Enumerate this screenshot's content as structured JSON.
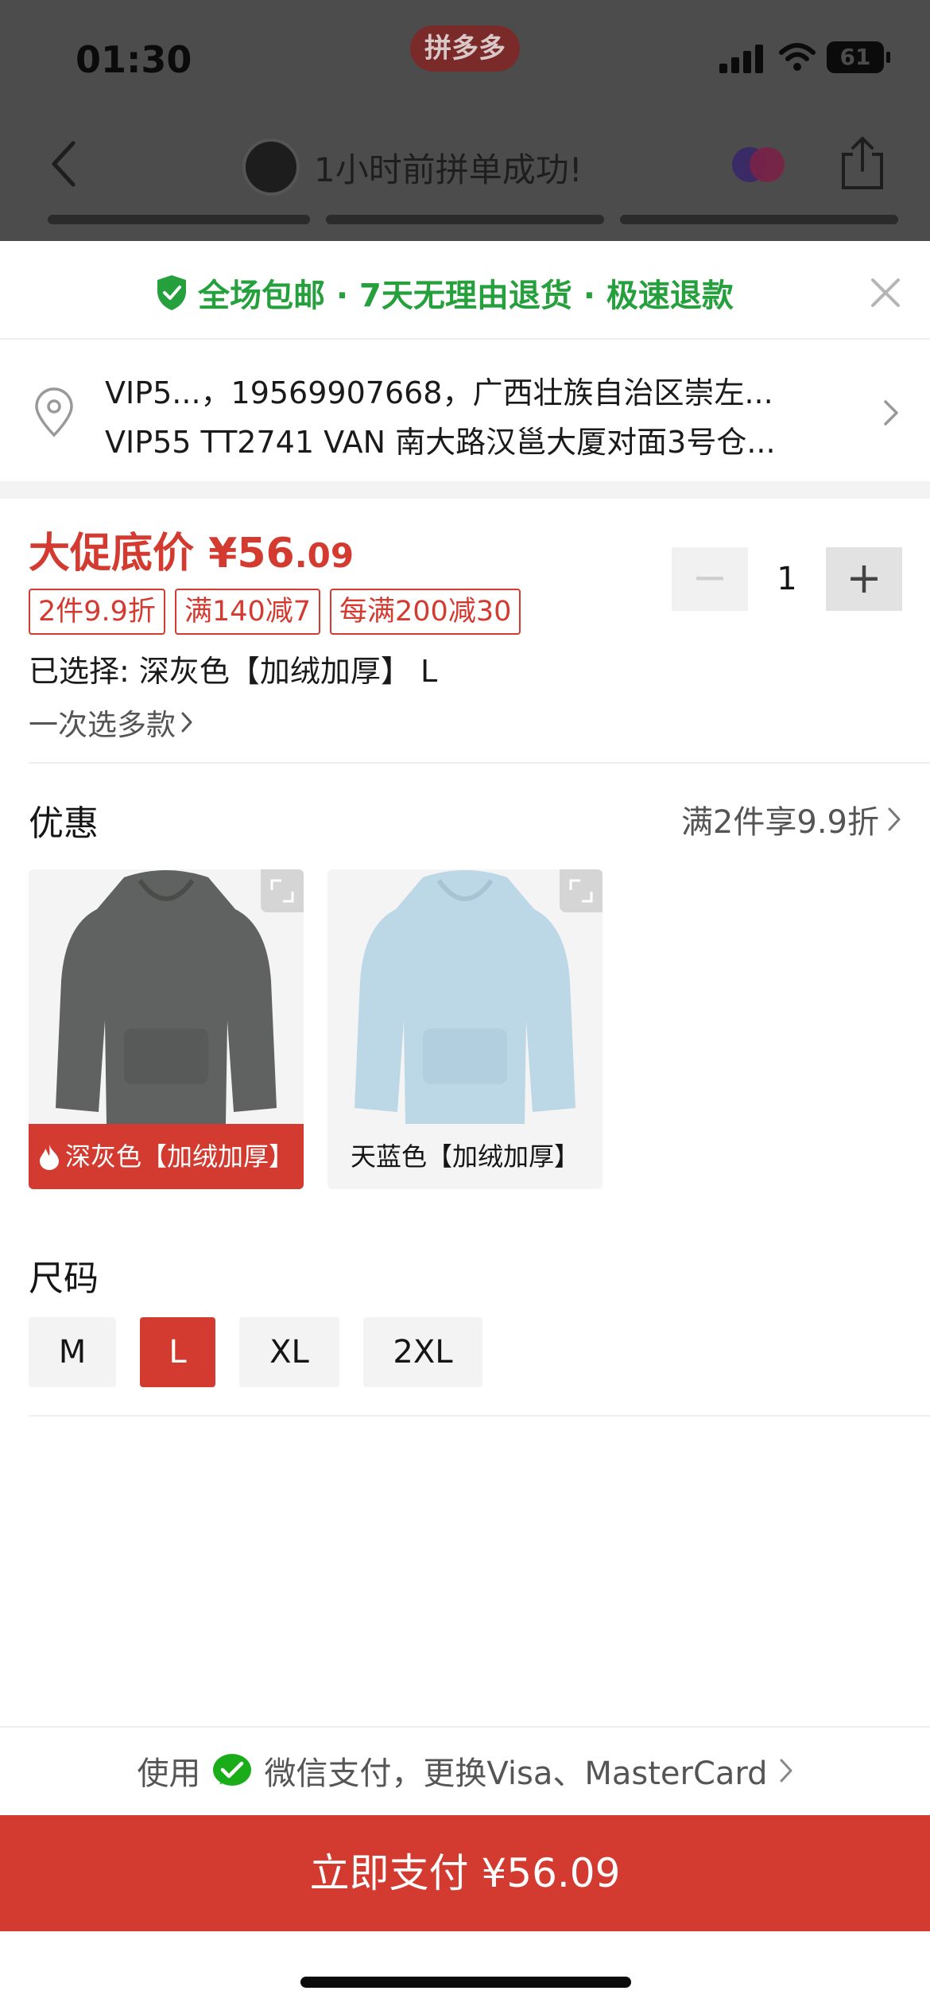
{
  "status_bar": {
    "time": "01:30",
    "app_badge": "拼多多",
    "battery": "61"
  },
  "nav": {
    "group_status": "1小时前拼单成功!"
  },
  "promo": {
    "text": "全场包邮 · 7天无理由退货 · 极速退款"
  },
  "address": {
    "line1": "VIP5...，19569907668，广西壮族自治区崇左...",
    "line2": "VIP55 TT2741 VAN  南大路汉邕大厦对面3号仓..."
  },
  "price": {
    "label": "大促底价",
    "symbol": "¥",
    "integer": "56",
    "decimal": ".09"
  },
  "quantity": {
    "minus": "−",
    "value": "1",
    "plus": "+"
  },
  "tags": [
    "2件9.9折",
    "满140减7",
    "每满200减30"
  ],
  "selection": {
    "text": "已选择: 深灰色【加绒加厚】 L"
  },
  "multi_select": {
    "label": "一次选多款"
  },
  "discount": {
    "title": "优惠",
    "summary": "满2件享9.9折"
  },
  "variants": [
    {
      "label": "深灰色【加绒加厚】",
      "color": "#5f6260",
      "selected": true
    },
    {
      "label": "天蓝色【加绒加厚】",
      "color": "#bcd7e6",
      "selected": false
    }
  ],
  "size": {
    "title": "尺码",
    "options": [
      "M",
      "L",
      "XL",
      "2XL"
    ],
    "selected": "L"
  },
  "payment": {
    "prefix": "使用",
    "method": "微信支付，更换Visa、MasterCard"
  },
  "cta": {
    "label": "立即支付 ¥56.09"
  },
  "colors": {
    "accent": "#d33a30",
    "promo_green": "#25a03c",
    "wechat_green": "#1aad19"
  }
}
